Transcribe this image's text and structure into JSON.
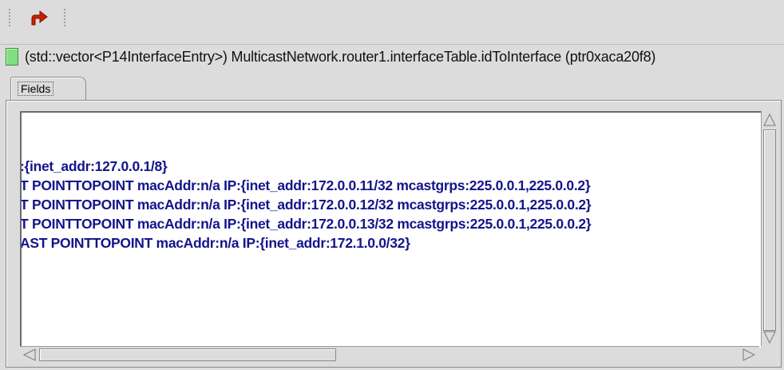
{
  "toolbar": {
    "buttons": [
      {
        "icon": "go-to-parent-icon",
        "color": "#d01c00"
      }
    ]
  },
  "info_bar": {
    "status_color": "#7ee07e",
    "text": "(std::vector<P14InterfaceEntry>) MulticastNetwork.router1.interfaceTable.idToInterface  (ptr0xaca20f8)"
  },
  "tabs": [
    {
      "label": "Fields"
    }
  ],
  "content": {
    "text_color": "#14148c",
    "lines": [
      ":{inet_addr:127.0.0.1/8}",
      "T POINTTOPOINT  macAddr:n/a IP:{inet_addr:172.0.0.11/32 mcastgrps:225.0.0.1,225.0.0.2}",
      "T POINTTOPOINT  macAddr:n/a IP:{inet_addr:172.0.0.12/32 mcastgrps:225.0.0.1,225.0.0.2}",
      "T POINTTOPOINT  macAddr:n/a IP:{inet_addr:172.0.0.13/32 mcastgrps:225.0.0.1,225.0.0.2}",
      "AST POINTTOPOINT  macAddr:n/a IP:{inet_addr:172.1.0.0/32}"
    ]
  }
}
